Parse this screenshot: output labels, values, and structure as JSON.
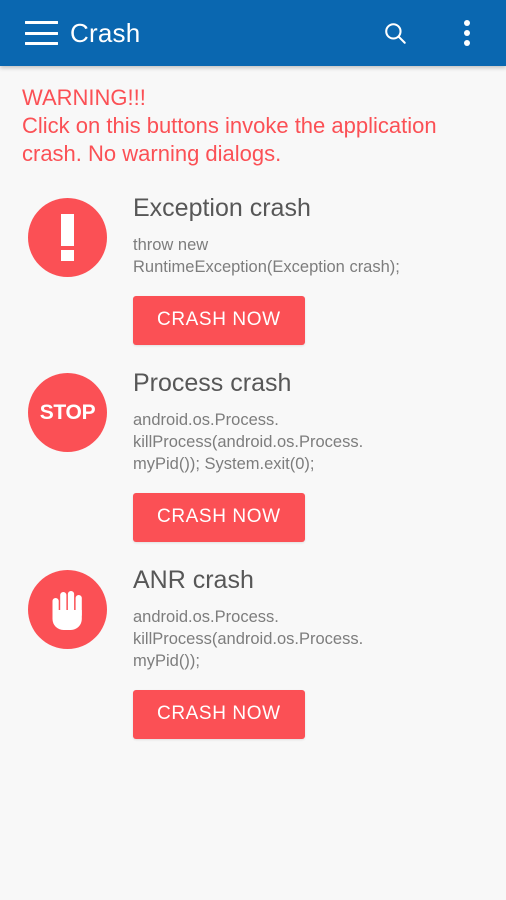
{
  "appbar": {
    "menu_icon": "hamburger-menu-icon",
    "title": "Crash",
    "search_icon": "search-icon",
    "overflow_icon": "overflow-menu-icon"
  },
  "warning": {
    "heading": "WARNING!!!",
    "body": "Click on this buttons invoke the application crash. No warning dialogs.",
    "color": "#fb5055"
  },
  "theme": {
    "primary": "#0a67b0",
    "accent": "#fb5055",
    "background": "#f8f8f8",
    "title_text": "#575757",
    "desc_text": "#7d7d7d"
  },
  "crash_items": [
    {
      "icon": "exclamation-circle-icon",
      "title": "Exception crash",
      "description": "throw new\nRuntimeException(Exception crash);",
      "button_label": "CRASH NOW"
    },
    {
      "icon": "stop-circle-icon",
      "icon_text": "STOP",
      "title": "Process crash",
      "description": "android.os.Process.\nkillProcess(android.os.Process.\nmyPid()); System.exit(0);",
      "button_label": "CRASH NOW"
    },
    {
      "icon": "hand-circle-icon",
      "title": "ANR crash",
      "description": "android.os.Process.\nkillProcess(android.os.Process.\nmyPid());",
      "button_label": "CRASH NOW"
    }
  ]
}
